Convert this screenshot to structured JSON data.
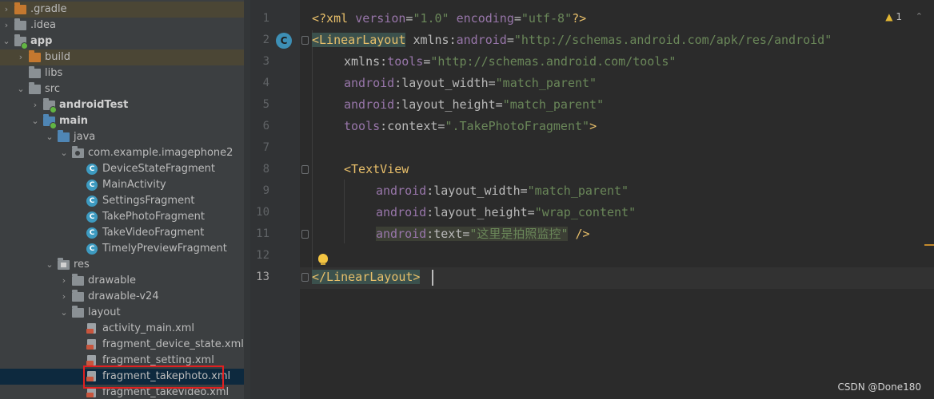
{
  "tree": {
    "items": [
      {
        "label": ".gradle",
        "icon": "folder-icon"
      },
      {
        "label": ".idea",
        "icon": "folder-icon"
      },
      {
        "label": "app",
        "icon": "module-folder-icon"
      },
      {
        "label": "build",
        "icon": "folder-icon"
      },
      {
        "label": "libs",
        "icon": "folder-icon"
      },
      {
        "label": "src",
        "icon": "folder-icon"
      },
      {
        "label": "androidTest",
        "icon": "folder-icon"
      },
      {
        "label": "main",
        "icon": "folder-icon"
      },
      {
        "label": "java",
        "icon": "folder-icon"
      },
      {
        "label": "com.example.imagephone2",
        "icon": "package-icon"
      },
      {
        "label": "DeviceStateFragment",
        "icon": "class-icon"
      },
      {
        "label": "MainActivity",
        "icon": "class-icon"
      },
      {
        "label": "SettingsFragment",
        "icon": "class-icon"
      },
      {
        "label": "TakePhotoFragment",
        "icon": "class-icon"
      },
      {
        "label": "TakeVideoFragment",
        "icon": "class-icon"
      },
      {
        "label": "TimelyPreviewFragment",
        "icon": "class-icon"
      },
      {
        "label": "res",
        "icon": "folder-icon"
      },
      {
        "label": "drawable",
        "icon": "folder-icon"
      },
      {
        "label": "drawable-v24",
        "icon": "folder-icon"
      },
      {
        "label": "layout",
        "icon": "folder-icon"
      },
      {
        "label": "activity_main.xml",
        "icon": "xml-file-icon"
      },
      {
        "label": "fragment_device_state.xml",
        "icon": "xml-file-icon"
      },
      {
        "label": "fragment_setting.xml",
        "icon": "xml-file-icon"
      },
      {
        "label": "fragment_takephoto.xml",
        "icon": "xml-file-icon"
      },
      {
        "label": "fragment_takevideo.xml",
        "icon": "xml-file-icon"
      }
    ],
    "selected": "fragment_takephoto.xml"
  },
  "editor": {
    "line_numbers": [
      "1",
      "2",
      "3",
      "4",
      "5",
      "6",
      "7",
      "8",
      "9",
      "10",
      "11",
      "12",
      "13"
    ],
    "current_line": "13",
    "gutter_class_icon": "C",
    "warnings": "1",
    "code": {
      "l1": {
        "open": "<?xml ",
        "a1": "version",
        "eq1": "=",
        "v1": "\"1.0\"",
        "sp": " ",
        "a2": "encoding",
        "eq2": "=",
        "v2": "\"utf-8\"",
        "close": "?>"
      },
      "l2": {
        "tag": "<LinearLayout",
        "sp": " ",
        "ns": "xmlns",
        "colon": ":",
        "an": "android",
        "eq": "=",
        "v": "\"http://schemas.android.com/apk/res/android\""
      },
      "l3": {
        "ns": "xmlns",
        "colon": ":",
        "an": "tools",
        "eq": "=",
        "v": "\"http://schemas.android.com/tools\""
      },
      "l4": {
        "ns": "android",
        "colon": ":",
        "an": "layout_width",
        "eq": "=",
        "v": "\"match_parent\""
      },
      "l5": {
        "ns": "android",
        "colon": ":",
        "an": "layout_height",
        "eq": "=",
        "v": "\"match_parent\""
      },
      "l6": {
        "ns": "tools",
        "colon": ":",
        "an": "context",
        "eq": "=",
        "v": "\".TakePhotoFragment\"",
        "close": ">"
      },
      "l8": {
        "tag": "<TextView"
      },
      "l9": {
        "ns": "android",
        "colon": ":",
        "an": "layout_width",
        "eq": "=",
        "v": "\"match_parent\""
      },
      "l10": {
        "ns": "android",
        "colon": ":",
        "an": "layout_height",
        "eq": "=",
        "v": "\"wrap_content\""
      },
      "l11": {
        "ns": "android",
        "colon": ":",
        "an": "text",
        "eq": "=",
        "v": "\"这里是拍照监控\"",
        "close": " />"
      },
      "l13": {
        "tag": "</LinearLayout>"
      }
    }
  },
  "watermark": "CSDN @Done180",
  "colors": {
    "tree_bg": "#3c3f41",
    "editor_bg": "#2b2b2b",
    "tag": "#e8bf6a",
    "attr_ns": "#9876aa",
    "string": "#6a8759",
    "selection": "#0d293e",
    "highlight_box": "#e02020"
  }
}
